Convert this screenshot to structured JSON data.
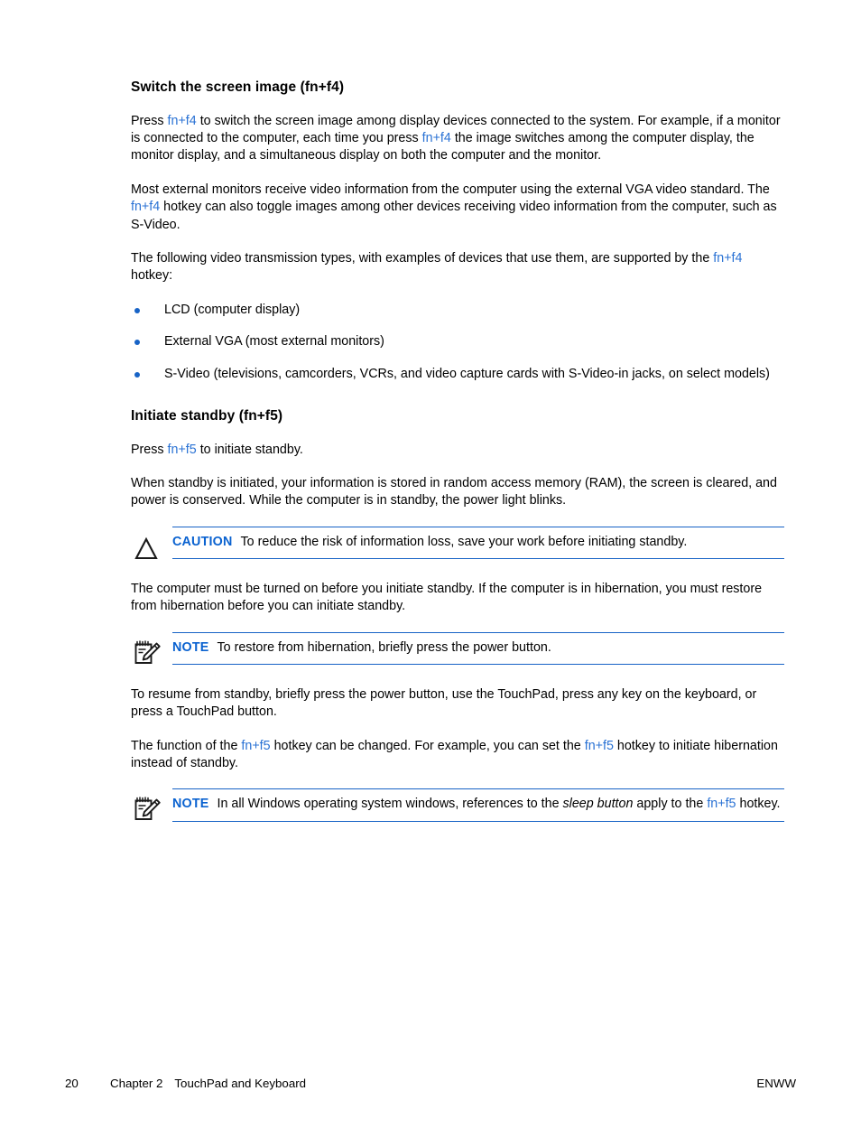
{
  "document": {
    "sections": [
      {
        "heading": "Switch the screen image (fn+f4)",
        "paragraphs": [
          {
            "p1_a": "Press ",
            "p1_link1": "fn+f4",
            "p1_b": " to switch the screen image among display devices connected to the system. For example, if a monitor is connected to the computer, each time you press ",
            "p1_link2": "fn+f4",
            "p1_c": " the image switches among the computer display, the monitor display, and a simultaneous display on both the computer and the monitor."
          },
          {
            "p2_a": "Most external monitors receive video information from the computer using the external VGA video standard. The ",
            "p2_link1": "fn+f4",
            "p2_b": " hotkey can also toggle images among other devices receiving video information from the computer, such as S-Video."
          },
          {
            "p3_a": "The following video transmission types, with examples of devices that use them, are supported by the ",
            "p3_link1": "fn+f4",
            "p3_b": " hotkey:"
          }
        ],
        "bullets": [
          "LCD (computer display)",
          "External VGA (most external monitors)",
          "S-Video (televisions, camcorders, VCRs, and video capture cards with S-Video-in jacks, on select models)"
        ]
      },
      {
        "heading": "Initiate standby (fn+f5)",
        "p4_a": "Press ",
        "p4_link1": "fn+f5",
        "p4_b": " to initiate standby.",
        "p5": "When standby is initiated, your information is stored in random access memory (RAM), the screen is cleared, and power is conserved. While the computer is in standby, the power light blinks.",
        "caution": {
          "icon": "warning-triangle-icon",
          "label": "CAUTION",
          "text": "To reduce the risk of information loss, save your work before initiating standby."
        },
        "p6": "The computer must be turned on before you initiate standby. If the computer is in hibernation, you must restore from hibernation before you can initiate standby.",
        "note1": {
          "icon": "notepad-pencil-icon",
          "label": "NOTE",
          "text": "To restore from hibernation, briefly press the power button."
        },
        "p7": "To resume from standby, briefly press the power button, use the TouchPad, press any key on the keyboard, or press a TouchPad button.",
        "p8_a": "The function of the ",
        "p8_link1": "fn+f5",
        "p8_b": " hotkey can be changed. For example, you can set the ",
        "p8_link2": "fn+f5",
        "p8_c": " hotkey to initiate hibernation instead of standby.",
        "note2": {
          "icon": "notepad-pencil-icon",
          "label": "NOTE",
          "text_a": "In all Windows operating system windows, references to the ",
          "text_italic": "sleep button",
          "text_b": " apply to the ",
          "text_link": "fn+f5",
          "text_c": " hotkey."
        }
      }
    ]
  },
  "footer": {
    "page_number": "20",
    "chapter": "Chapter 2",
    "chapter_title": "TouchPad and Keyboard",
    "language_code": "ENWW"
  },
  "colors": {
    "link_blue": "#2a72d4",
    "rule_blue": "#1763c6",
    "label_blue": "#0a62d0",
    "bullet_blue": "#1763c6",
    "text_black": "#000000",
    "page_background": "#ffffff"
  }
}
